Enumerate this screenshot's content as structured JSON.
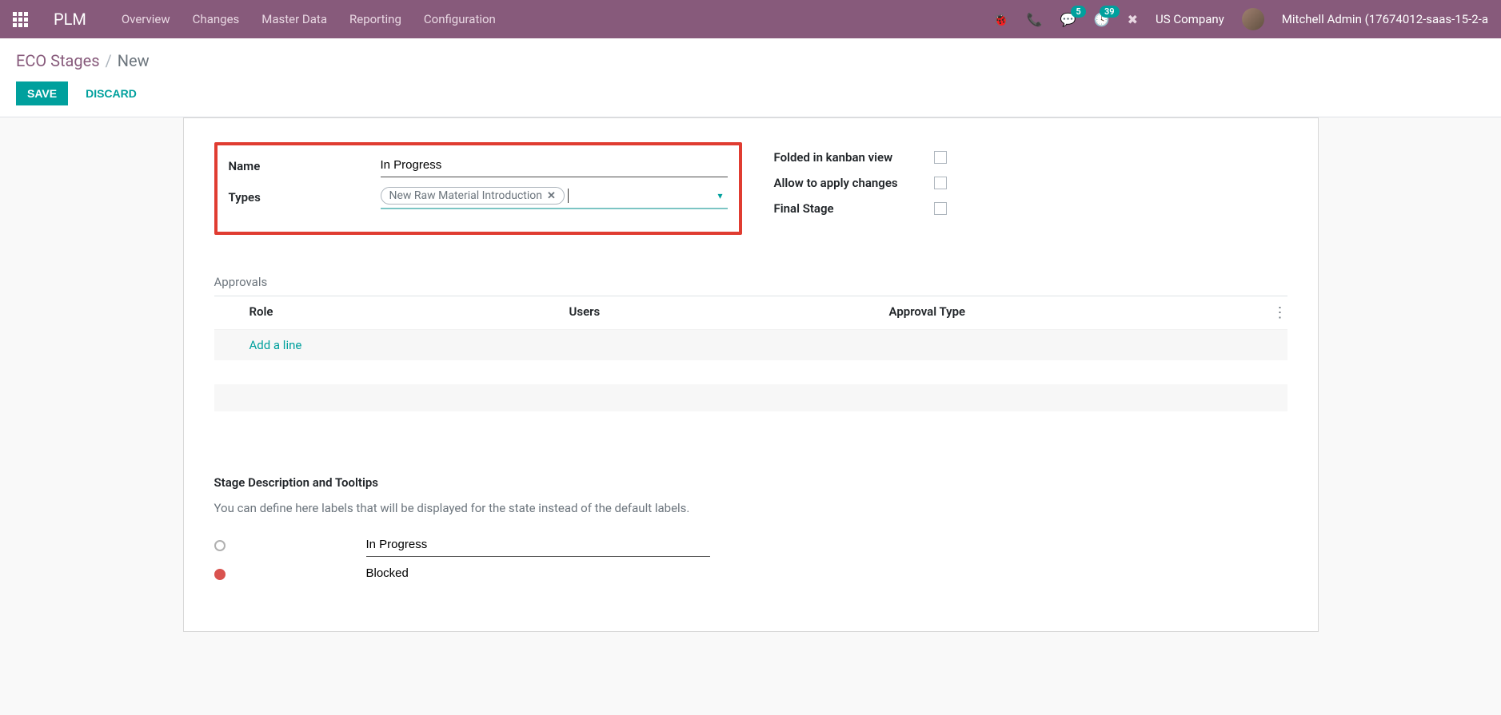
{
  "navbar": {
    "app_name": "PLM",
    "menu": [
      "Overview",
      "Changes",
      "Master Data",
      "Reporting",
      "Configuration"
    ],
    "messages_badge": "5",
    "activities_badge": "39",
    "company": "US Company",
    "user": "Mitchell Admin (17674012-saas-15-2-a"
  },
  "breadcrumb": {
    "parent": "ECO Stages",
    "current": "New"
  },
  "actions": {
    "save": "SAVE",
    "discard": "DISCARD"
  },
  "form": {
    "name_label": "Name",
    "name_value": "In Progress",
    "types_label": "Types",
    "types_tag": "New Raw Material Introduction",
    "folded_label": "Folded in kanban view",
    "allow_label": "Allow to apply changes",
    "final_label": "Final Stage"
  },
  "approvals": {
    "title": "Approvals",
    "col_role": "Role",
    "col_users": "Users",
    "col_approval": "Approval Type",
    "add_line": "Add a line"
  },
  "description": {
    "title": "Stage Description and Tooltips",
    "help": "You can define here labels that will be displayed for the state instead of the default labels.",
    "state_normal": "In Progress",
    "state_blocked": "Blocked"
  }
}
